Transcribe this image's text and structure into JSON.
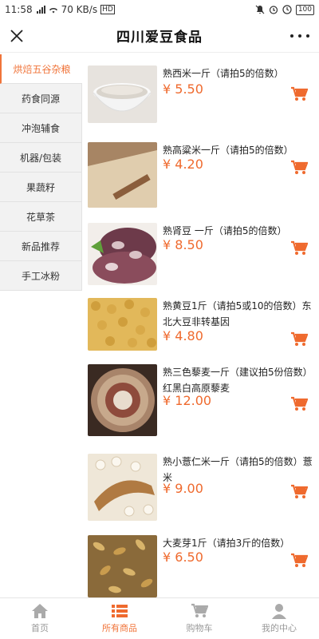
{
  "status_bar": {
    "time": "11:58",
    "net_speed": "70 KB/s",
    "net_type": "HD",
    "battery": "100"
  },
  "header": {
    "title": "四川爱豆食品"
  },
  "sidebar": {
    "items": [
      {
        "label": "烘焙五谷杂粮",
        "active": true
      },
      {
        "label": "药食同源",
        "active": false
      },
      {
        "label": "冲泡辅食",
        "active": false
      },
      {
        "label": "机器/包装",
        "active": false
      },
      {
        "label": "果蔬籽",
        "active": false
      },
      {
        "label": "花草茶",
        "active": false
      },
      {
        "label": "新品推荐",
        "active": false
      },
      {
        "label": "手工冰粉",
        "active": false
      }
    ]
  },
  "products": [
    {
      "name": "熟西米一斤（请拍5的倍数）",
      "price": "¥ 5.50"
    },
    {
      "name": "熟高粱米一斤（请拍5的倍数）",
      "price": "¥ 4.20"
    },
    {
      "name": "熟肾豆 一斤（请拍5的倍数）",
      "price": "¥ 8.50"
    },
    {
      "name": "熟黄豆1斤（请拍5或10的倍数）东北大豆非转基因",
      "price": "¥ 4.80"
    },
    {
      "name": "熟三色藜麦一斤（建议拍5份倍数）红黑白高原藜麦",
      "price": "¥ 12.00"
    },
    {
      "name": "熟小薏仁米一斤（请拍5的倍数）薏米",
      "price": "¥ 9.00"
    },
    {
      "name": "大麦芽1斤（请拍3斤的倍数）",
      "price": "¥ 6.50"
    }
  ],
  "bottom_nav": {
    "items": [
      {
        "label": "首页",
        "icon": "home-icon",
        "active": false
      },
      {
        "label": "所有商品",
        "icon": "list-icon",
        "active": true
      },
      {
        "label": "购物车",
        "icon": "cart-icon",
        "active": false
      },
      {
        "label": "我的中心",
        "icon": "user-icon",
        "active": false
      }
    ]
  },
  "colors": {
    "accent": "#ef6a2e",
    "sidebar_bg": "#f2f2f2"
  }
}
